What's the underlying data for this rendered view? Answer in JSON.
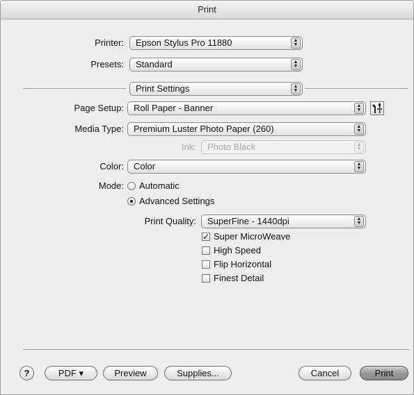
{
  "window": {
    "title": "Print"
  },
  "printer": {
    "label": "Printer:",
    "value": "Epson Stylus Pro 11880"
  },
  "presets": {
    "label": "Presets:",
    "value": "Standard"
  },
  "panel": {
    "value": "Print Settings"
  },
  "page_setup": {
    "label": "Page Setup:",
    "value": "Roll Paper - Banner"
  },
  "media_type": {
    "label": "Media Type:",
    "value": "Premium Luster Photo Paper (260)"
  },
  "ink": {
    "label": "Ink:",
    "value": "Photo Black"
  },
  "color": {
    "label": "Color:",
    "value": "Color"
  },
  "mode": {
    "label": "Mode:",
    "options": [
      {
        "label": "Automatic",
        "selected": false
      },
      {
        "label": "Advanced Settings",
        "selected": true
      }
    ]
  },
  "print_quality": {
    "label": "Print Quality:",
    "value": "SuperFine - 1440dpi"
  },
  "options": [
    {
      "label": "Super MicroWeave",
      "checked": true
    },
    {
      "label": "High Speed",
      "checked": false
    },
    {
      "label": "Flip Horizontal",
      "checked": false
    },
    {
      "label": "Finest Detail",
      "checked": false
    }
  ],
  "buttons": {
    "help": "?",
    "pdf": "PDF ▾",
    "preview": "Preview",
    "supplies": "Supplies...",
    "cancel": "Cancel",
    "print": "Print"
  },
  "icons": {
    "popup_arrows": "updown-arrows-icon",
    "utility": "wrench-screwdriver-icon"
  }
}
